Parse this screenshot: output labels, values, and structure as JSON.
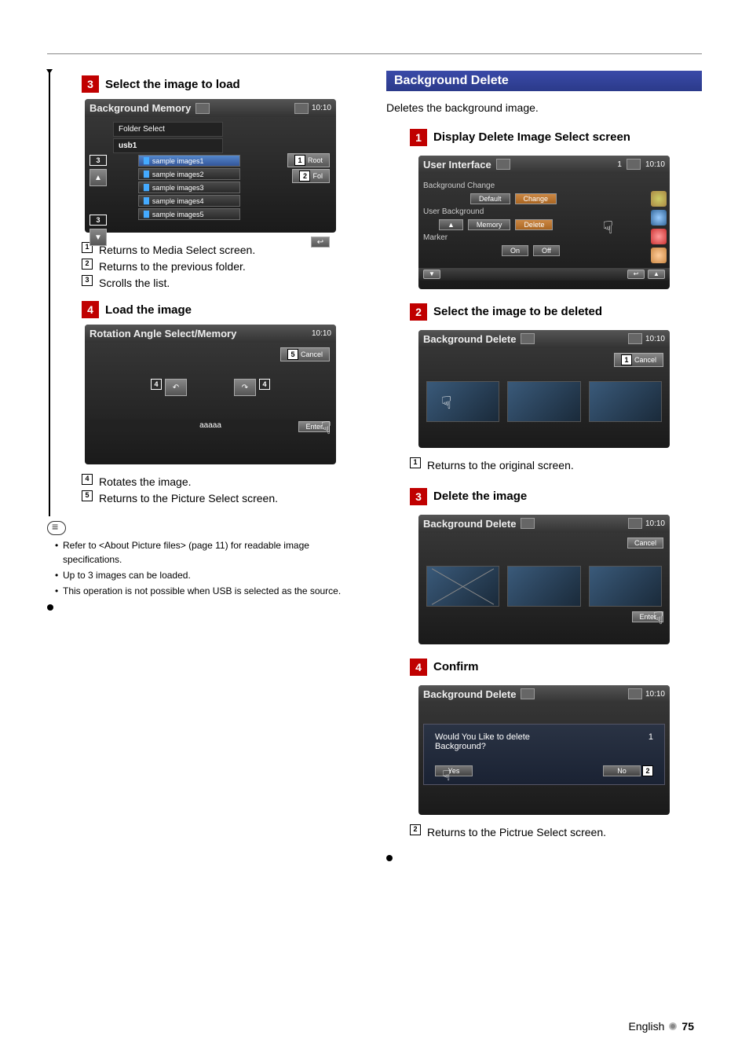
{
  "left": {
    "step3": {
      "num": "3",
      "title": "Select the image to load",
      "screen_title": "Background Memory",
      "clock": "10:10",
      "folder_select_label": "Folder Select",
      "folder_name": "usb1",
      "files": [
        "sample images1",
        "sample images2",
        "sample images3",
        "sample images4",
        "sample images5"
      ],
      "root_btn": "Root",
      "fol_btn": "Fol",
      "refs": [
        {
          "n": "1",
          "t": "Returns to Media Select screen."
        },
        {
          "n": "2",
          "t": "Returns to the previous folder."
        },
        {
          "n": "3",
          "t": "Scrolls the list."
        }
      ]
    },
    "step4": {
      "num": "4",
      "title": "Load the image",
      "screen_title": "Rotation Angle Select/Memory",
      "clock": "10:10",
      "cancel": "Cancel",
      "filename": "aaaaa",
      "enter": "Enter",
      "refs": [
        {
          "n": "4",
          "t": "Rotates the image."
        },
        {
          "n": "5",
          "t": "Returns to the Picture Select screen."
        }
      ]
    },
    "notes": [
      "Refer to <About Picture files> (page 11) for readable image specifications.",
      "Up to 3 images can be loaded.",
      "This operation is not possible when USB is selected as the source."
    ]
  },
  "right": {
    "heading": "Background Delete",
    "subtitle": "Deletes the background image.",
    "step1": {
      "num": "1",
      "title": "Display Delete Image Select screen",
      "screen_title": "User Interface",
      "page_ind": "1",
      "clock": "10:10",
      "rows": {
        "bg_change": "Background Change",
        "default": "Default",
        "change": "Change",
        "user_bg": "User Background",
        "memory": "Memory",
        "delete": "Delete",
        "marker": "Marker",
        "on": "On",
        "off": "Off"
      }
    },
    "step2": {
      "num": "2",
      "title": "Select the image to be deleted",
      "screen_title": "Background Delete",
      "clock": "10:10",
      "cancel": "Cancel",
      "refs": [
        {
          "n": "1",
          "t": "Returns to the original screen."
        }
      ]
    },
    "step3": {
      "num": "3",
      "title": "Delete the image",
      "screen_title": "Background Delete",
      "clock": "10:10",
      "cancel": "Cancel",
      "enter": "Enter"
    },
    "step4": {
      "num": "4",
      "title": "Confirm",
      "screen_title": "Background Delete",
      "clock": "10:10",
      "dialog_line1": "Would You Like to delete",
      "dialog_line2": "Background?",
      "dialog_num": "1",
      "yes": "Yes",
      "no": "No",
      "refs": [
        {
          "n": "2",
          "t": "Returns to the Pictrue Select screen."
        }
      ]
    }
  },
  "footer": {
    "lang": "English",
    "page": "75"
  }
}
